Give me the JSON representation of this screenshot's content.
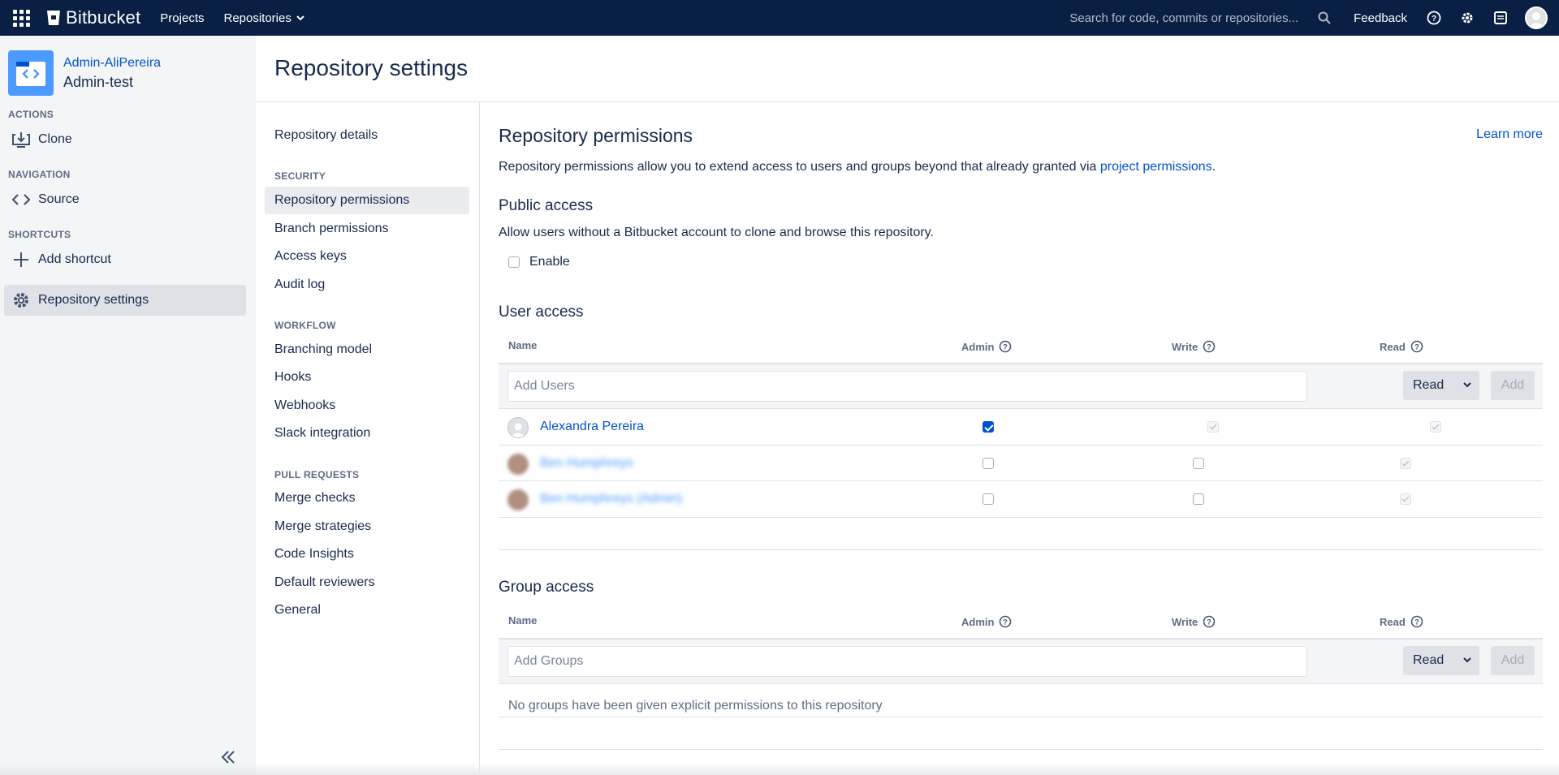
{
  "topbar": {
    "brand": "Bitbucket",
    "nav": {
      "projects": "Projects",
      "repositories": "Repositories"
    },
    "search_placeholder": "Search for code, commits or repositories...",
    "feedback": "Feedback"
  },
  "sidebar": {
    "project": "Admin-AliPereira",
    "repo": "Admin-test",
    "sections": {
      "actions": "ACTIONS",
      "navigation": "NAVIGATION",
      "shortcuts": "SHORTCUTS"
    },
    "items": {
      "clone": "Clone",
      "source": "Source",
      "add_shortcut": "Add shortcut",
      "repo_settings": "Repository settings"
    }
  },
  "page": {
    "title": "Repository settings"
  },
  "settings_nav": {
    "details": "Repository details",
    "security_heading": "SECURITY",
    "security": [
      "Repository permissions",
      "Branch permissions",
      "Access keys",
      "Audit log"
    ],
    "workflow_heading": "WORKFLOW",
    "workflow": [
      "Branching model",
      "Hooks",
      "Webhooks",
      "Slack integration"
    ],
    "pr_heading": "PULL REQUESTS",
    "pull_requests": [
      "Merge checks",
      "Merge strategies",
      "Code Insights",
      "Default reviewers",
      "General"
    ]
  },
  "content": {
    "title": "Repository permissions",
    "learn_more": "Learn more",
    "desc_prefix": "Repository permissions allow you to extend access to users and groups beyond that already granted via ",
    "desc_link": "project permissions",
    "desc_suffix": ".",
    "public_access": {
      "title": "Public access",
      "desc": "Allow users without a Bitbucket account to clone and browse this repository.",
      "enable_label": "Enable",
      "enabled": false
    },
    "user_access": {
      "title": "User access",
      "columns": {
        "name": "Name",
        "admin": "Admin",
        "write": "Write",
        "read": "Read"
      },
      "add_placeholder": "Add Users",
      "select_value": "Read",
      "add_button": "Add",
      "rows": [
        {
          "name": "Alexandra Pereira",
          "admin": true,
          "write": true,
          "read": true,
          "blurred": false
        },
        {
          "name": "Ben Humphreys",
          "admin": false,
          "write": false,
          "read": true,
          "blurred": true
        },
        {
          "name": "Ben Humphreys (Admin)",
          "admin": false,
          "write": false,
          "read": true,
          "blurred": true
        }
      ]
    },
    "group_access": {
      "title": "Group access",
      "columns": {
        "name": "Name",
        "admin": "Admin",
        "write": "Write",
        "read": "Read"
      },
      "add_placeholder": "Add Groups",
      "select_value": "Read",
      "add_button": "Add",
      "empty_message": "No groups have been given explicit permissions to this repository"
    }
  },
  "colors": {
    "topbar": "#0a1f44",
    "link": "#0052cc",
    "sidebar_bg": "#f4f5f7"
  }
}
